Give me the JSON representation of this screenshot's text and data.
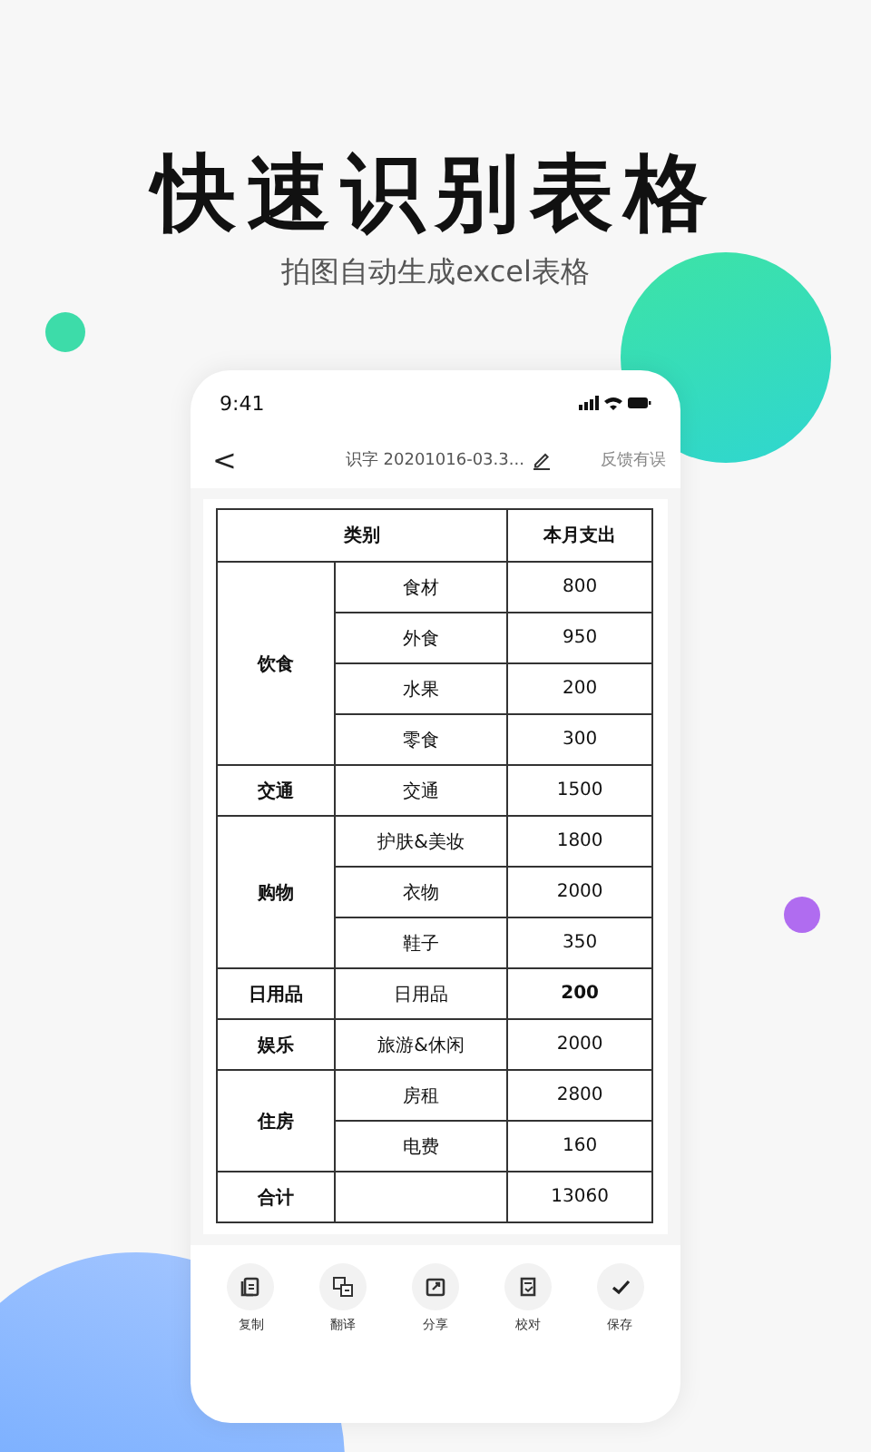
{
  "headline": "快速识别表格",
  "subtitle": "拍图自动生成excel表格",
  "phone": {
    "status_bar": {
      "time": "9:41"
    },
    "nav": {
      "back": "<",
      "title": "识字 20201016-03.3...",
      "feedback": "反馈有误"
    },
    "table": {
      "columns": [
        "类别",
        "本月支出"
      ],
      "groups": [
        {
          "category": "饮食",
          "items": [
            {
              "name": "食材",
              "amount": "800",
              "emphasized": false
            },
            {
              "name": "外食",
              "amount": "950",
              "emphasized": false
            },
            {
              "name": "水果",
              "amount": "200",
              "emphasized": false
            },
            {
              "name": "零食",
              "amount": "300",
              "emphasized": false
            }
          ]
        },
        {
          "category": "交通",
          "items": [
            {
              "name": "交通",
              "amount": "1500",
              "emphasized": false
            }
          ]
        },
        {
          "category": "购物",
          "items": [
            {
              "name": "护肤&美妆",
              "amount": "1800",
              "emphasized": false
            },
            {
              "name": "衣物",
              "amount": "2000",
              "emphasized": false
            },
            {
              "name": "鞋子",
              "amount": "350",
              "emphasized": false
            }
          ]
        },
        {
          "category": "日用品",
          "items": [
            {
              "name": "日用品",
              "amount": "200",
              "emphasized": true
            }
          ]
        },
        {
          "category": "娱乐",
          "items": [
            {
              "name": "旅游&休闲",
              "amount": "2000",
              "emphasized": false
            }
          ]
        },
        {
          "category": "住房",
          "items": [
            {
              "name": "房租",
              "amount": "2800",
              "emphasized": false
            },
            {
              "name": "电费",
              "amount": "160",
              "emphasized": false
            }
          ]
        }
      ],
      "total": {
        "label": "合计",
        "amount": "13060"
      }
    },
    "toolbar": [
      {
        "kind": "copy",
        "label": "复制"
      },
      {
        "kind": "translate",
        "label": "翻译"
      },
      {
        "kind": "share",
        "label": "分享"
      },
      {
        "kind": "proofread",
        "label": "校对"
      },
      {
        "kind": "save",
        "label": "保存"
      }
    ]
  }
}
